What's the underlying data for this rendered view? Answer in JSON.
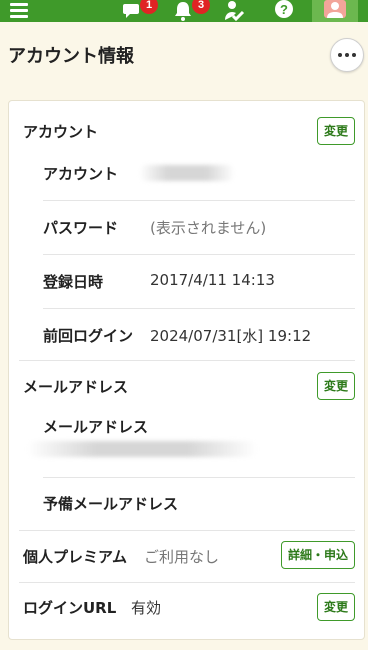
{
  "colors": {
    "brand_green": "#3f9a2a",
    "badge_red": "#e02424",
    "background": "#fbf7e8"
  },
  "topbar": {
    "icons": [
      "menu-icon",
      "chat-icon",
      "bell-icon",
      "check-icon",
      "help-icon",
      "user-avatar-icon"
    ],
    "chat_badge": "1",
    "bell_badge": "3"
  },
  "header": {
    "title": "アカウント情報"
  },
  "account": {
    "section_title": "アカウント",
    "change_label": "変更",
    "rows": [
      {
        "label": "アカウント",
        "value": ""
      },
      {
        "label": "パスワード",
        "value": "(表示されません)"
      },
      {
        "label": "登録日時",
        "value": "2017/4/11 14:13"
      },
      {
        "label": "前回ログイン",
        "value": "2024/07/31[水] 19:12"
      }
    ]
  },
  "email": {
    "section_title": "メールアドレス",
    "change_label": "変更",
    "address_label": "メールアドレス",
    "backup_label": "予備メールアドレス"
  },
  "premium": {
    "title": "個人プレミアム",
    "status": "ご利用なし",
    "button_label": "詳細・申込"
  },
  "login_url": {
    "title": "ログインURL",
    "status": "有効",
    "change_label": "変更"
  }
}
